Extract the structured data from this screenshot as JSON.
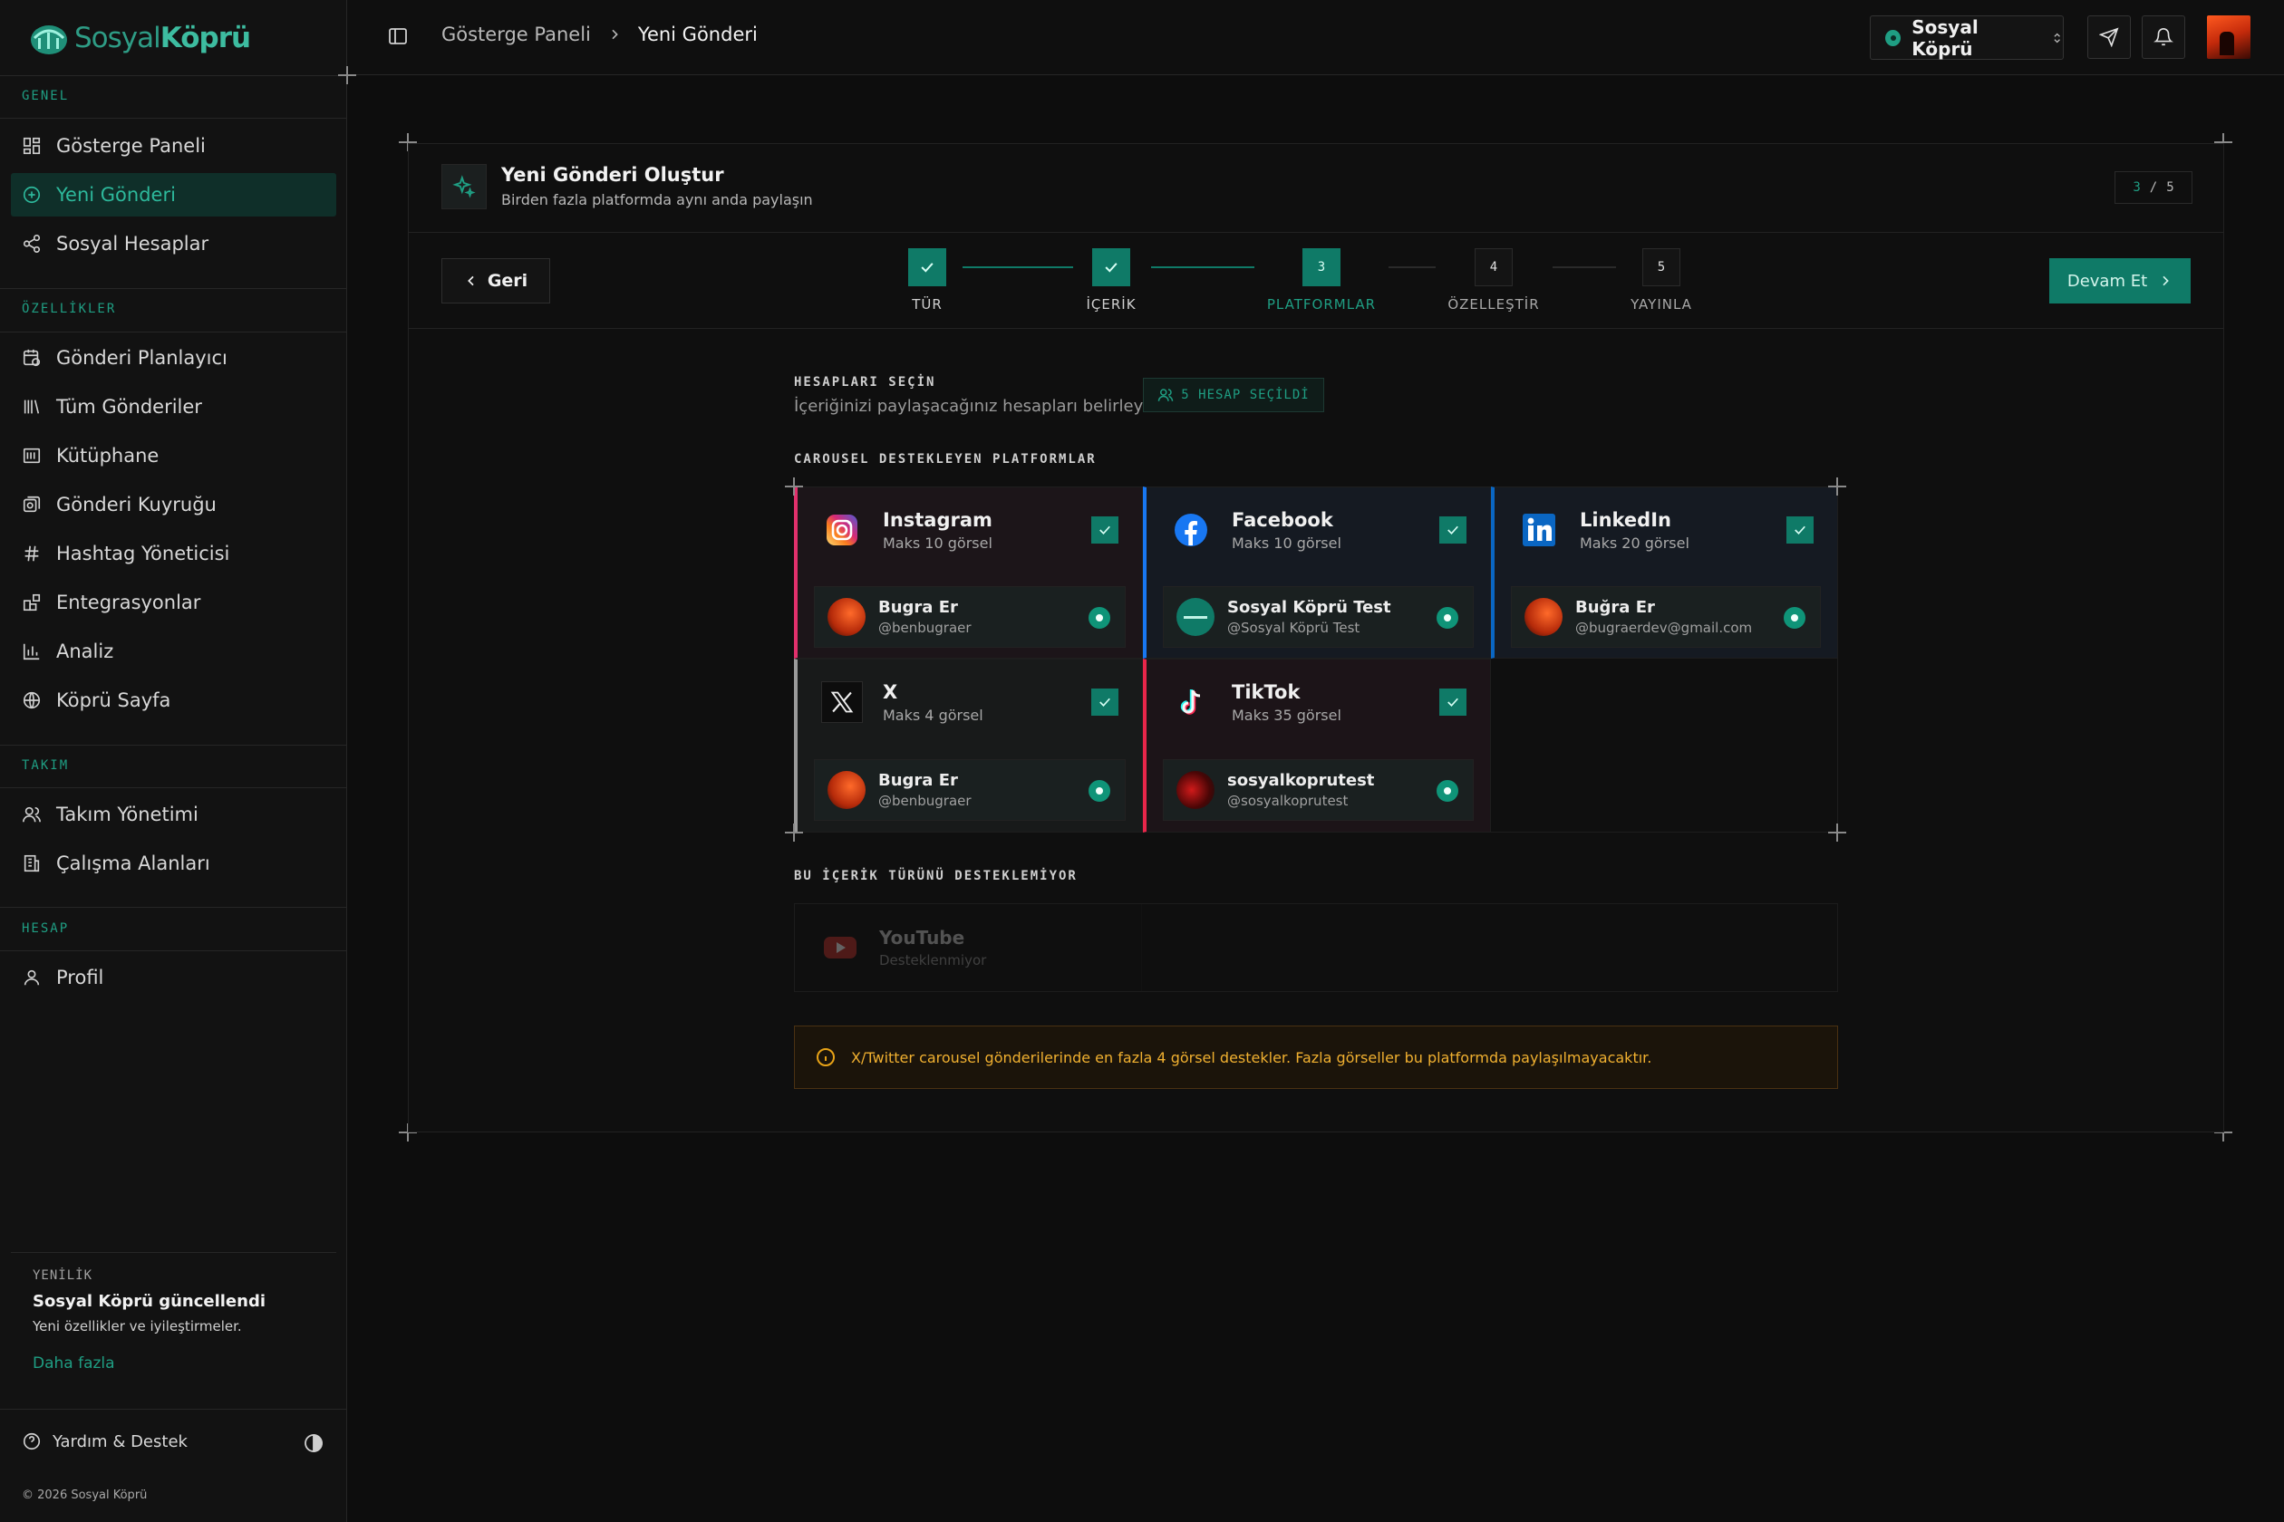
{
  "app": {
    "logo_a": "Sosyal",
    "logo_b": "Köprü"
  },
  "sidebar": {
    "sections": [
      {
        "title": "GENEL",
        "items": [
          {
            "label": "Gösterge Paneli",
            "icon": "dashboard-icon"
          },
          {
            "label": "Yeni Gönderi",
            "icon": "plus-circle-icon",
            "active": true
          },
          {
            "label": "Sosyal Hesaplar",
            "icon": "share-icon"
          }
        ]
      },
      {
        "title": "ÖZELLİKLER",
        "items": [
          {
            "label": "Gönderi Planlayıcı",
            "icon": "calendar-clock-icon"
          },
          {
            "label": "Tüm Gönderiler",
            "icon": "library-icon"
          },
          {
            "label": "Kütüphane",
            "icon": "archive-icon"
          },
          {
            "label": "Gönderi Kuyruğu",
            "icon": "queue-icon"
          },
          {
            "label": "Hashtag Yöneticisi",
            "icon": "hash-icon"
          },
          {
            "label": "Entegrasyonlar",
            "icon": "blocks-icon"
          },
          {
            "label": "Analiz",
            "icon": "chart-icon"
          },
          {
            "label": "Köprü Sayfa",
            "icon": "globe-icon"
          }
        ]
      },
      {
        "title": "TAKIM",
        "items": [
          {
            "label": "Takım Yönetimi",
            "icon": "users-icon"
          },
          {
            "label": "Çalışma Alanları",
            "icon": "building-icon"
          }
        ]
      },
      {
        "title": "HESAP",
        "items": [
          {
            "label": "Profil",
            "icon": "user-icon"
          }
        ]
      }
    ],
    "news": {
      "tag": "YENİLİK",
      "title": "Sosyal Köprü güncellendi",
      "desc": "Yeni özellikler ve iyileştirmeler.",
      "link": "Daha fazla"
    },
    "help": "Yardım & Destek",
    "copyright": "© 2026 Sosyal Köprü"
  },
  "header": {
    "breadcrumb_root": "Gösterge Paneli",
    "breadcrumb_current": "Yeni Gönderi",
    "workspace": "Sosyal Köprü"
  },
  "wizard": {
    "title": "Yeni Gönderi Oluştur",
    "subtitle": "Birden fazla platformda aynı anda paylaşın",
    "counter_current": "3",
    "counter_sep": "/",
    "counter_total": "5",
    "back_label": "Geri",
    "next_label": "Devam Et",
    "steps": [
      {
        "num": "1",
        "label": "TÜR",
        "state": "done"
      },
      {
        "num": "2",
        "label": "İÇERİK",
        "state": "done"
      },
      {
        "num": "3",
        "label": "PLATFORMLAR",
        "state": "current"
      },
      {
        "num": "4",
        "label": "ÖZELLEŞTİR",
        "state": "todo"
      },
      {
        "num": "5",
        "label": "YAYINLA",
        "state": "todo"
      }
    ]
  },
  "accounts": {
    "heading": "HESAPLARI SEÇİN",
    "subheading": "İçeriğinizi paylaşacağınız hesapları belirleyin",
    "selected_badge": "5 HESAP SEÇİLDİ",
    "carousel_heading": "CAROUSEL DESTEKLEYEN PLATFORMLAR",
    "platforms": [
      {
        "name": "Instagram",
        "max": "Maks 10 görsel",
        "accent": "#e1306c",
        "account_name": "Bugra Er",
        "account_handle": "@benbugraer"
      },
      {
        "name": "Facebook",
        "max": "Maks 10 görsel",
        "accent": "#1877f2",
        "account_name": "Sosyal Köprü Test",
        "account_handle": "@Sosyal Köprü Test"
      },
      {
        "name": "LinkedIn",
        "max": "Maks 20 görsel",
        "accent": "#0a66c2",
        "account_name": "Buğra Er",
        "account_handle": "@bugraerdev@gmail.com"
      },
      {
        "name": "X",
        "max": "Maks 4 görsel",
        "accent": "#9a9a9a",
        "account_name": "Bugra Er",
        "account_handle": "@benbugraer"
      },
      {
        "name": "TikTok",
        "max": "Maks 35 görsel",
        "accent": "#e8264a",
        "account_name": "sosyalkoprutest",
        "account_handle": "@sosyalkoprutest"
      }
    ],
    "unsupported_heading": "BU İÇERİK TÜRÜNÜ DESTEKLEMİYOR",
    "unsupported": {
      "name": "YouTube",
      "status": "Desteklenmiyor"
    },
    "warning": "X/Twitter carousel gönderilerinde en fazla 4 görsel destekler. Fazla görseller bu platformda paylaşılmayacaktır."
  },
  "colors": {
    "accent": "#1f9e83",
    "bg": "#0d0d0d",
    "warning": "#e8a317"
  }
}
